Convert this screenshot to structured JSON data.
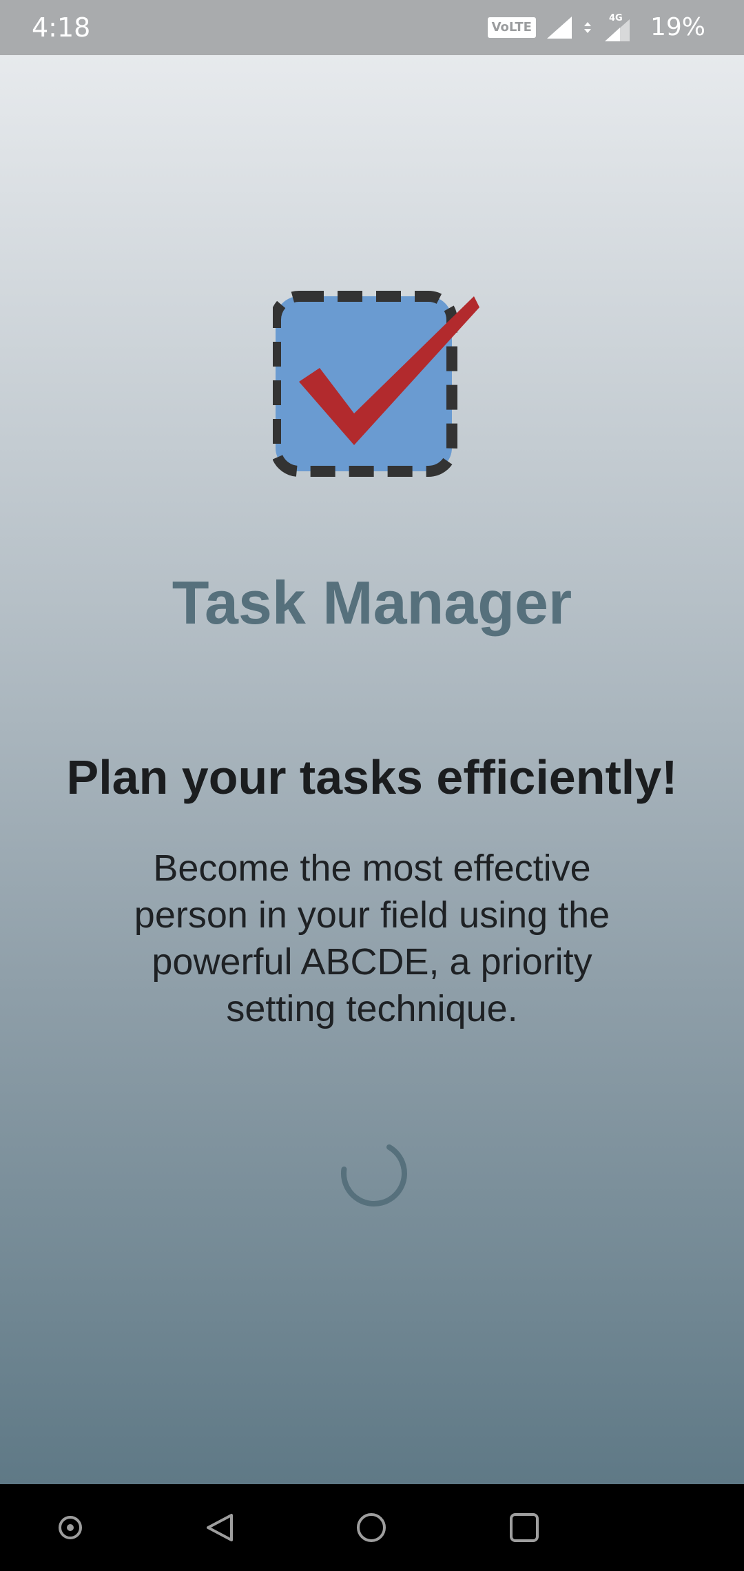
{
  "status_bar": {
    "time": "4:18",
    "volte": "VoLTE",
    "network": "4G",
    "battery": "19%"
  },
  "app": {
    "title": "Task Manager",
    "headline": "Plan your tasks efficiently!",
    "description": "Become the most effective person in your field using the powerful ABCDE, a priority setting technique.",
    "loading_icon": "loading-spinner"
  },
  "nav_bar": {
    "buttons": [
      "assistant",
      "back",
      "home",
      "recents"
    ]
  },
  "colors": {
    "title": "#56707c",
    "logo_fill": "#6a9bd1",
    "logo_check": "#b22a2d",
    "logo_border": "#333333",
    "spinner": "#56707c"
  }
}
